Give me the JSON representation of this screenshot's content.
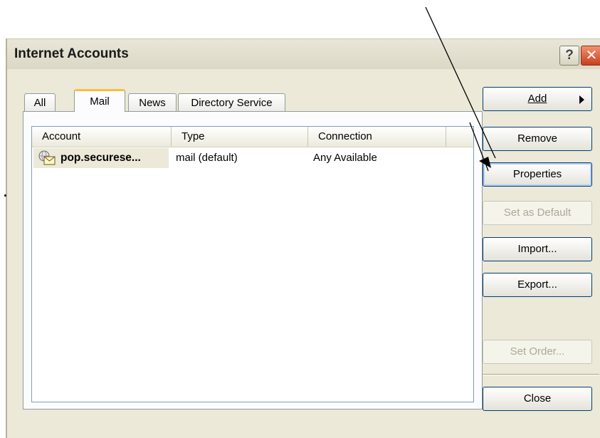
{
  "window": {
    "title": "Internet Accounts",
    "help_glyph": "?",
    "close_glyph": "✕"
  },
  "tabs": [
    {
      "label": "All",
      "active": false
    },
    {
      "label": "Mail",
      "active": true
    },
    {
      "label": "News",
      "active": false
    },
    {
      "label": "Directory Service",
      "active": false
    }
  ],
  "list": {
    "columns": [
      "Account",
      "Type",
      "Connection"
    ],
    "rows": [
      {
        "account": "pop.securese...",
        "type": "mail (default)",
        "connection": "Any Available",
        "icon": "mail-account-icon"
      }
    ]
  },
  "buttons": {
    "add": "Add",
    "remove": "Remove",
    "properties": "Properties",
    "set_default": "Set as Default",
    "import": "Import...",
    "export": "Export...",
    "set_order": "Set Order...",
    "close": "Close"
  },
  "colors": {
    "dialog_bg": "#ece9d8",
    "active_tab_accent": "#f5c13d",
    "close_button": "#c8401c",
    "button_border": "#003c74"
  }
}
